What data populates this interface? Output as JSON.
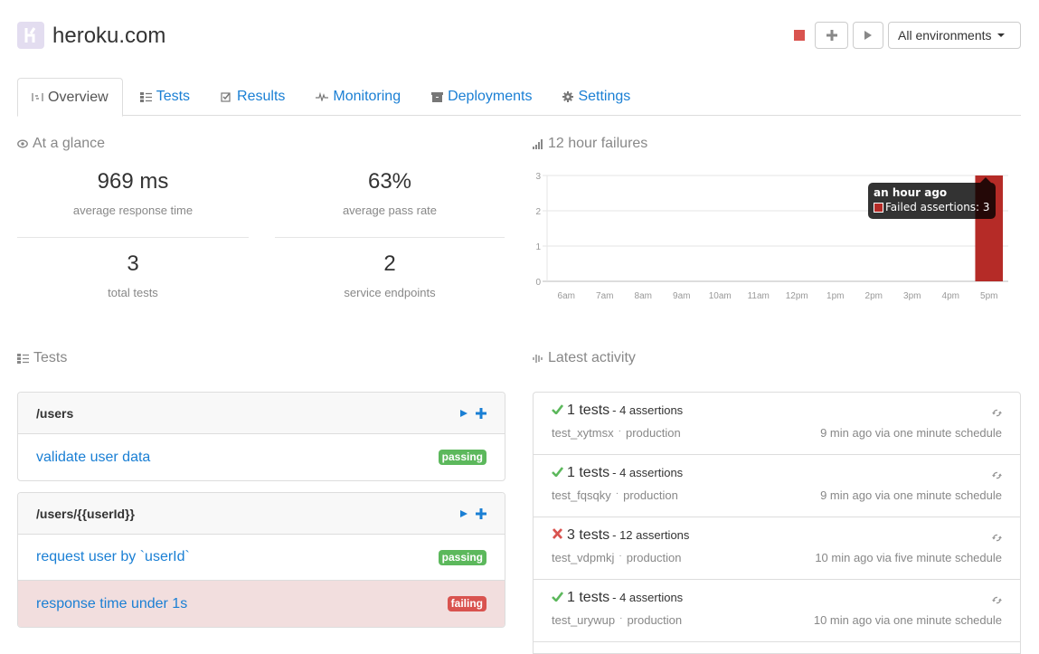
{
  "header": {
    "site_title": "heroku.com",
    "logo_icon": "heroku-logo-icon",
    "status_color": "#d9534f",
    "add_icon": "plus-icon",
    "run_icon": "play-icon",
    "environment_select": "All environments"
  },
  "tabs": [
    {
      "label": "Overview",
      "icon": "overview-icon",
      "active": true
    },
    {
      "label": "Tests",
      "icon": "tests-list-icon",
      "active": false
    },
    {
      "label": "Results",
      "icon": "checkbox-icon",
      "active": false
    },
    {
      "label": "Monitoring",
      "icon": "pulse-icon",
      "active": false
    },
    {
      "label": "Deployments",
      "icon": "archive-icon",
      "active": false
    },
    {
      "label": "Settings",
      "icon": "gear-icon",
      "active": false
    }
  ],
  "glance": {
    "title": "At a glance",
    "stats": [
      {
        "value": "969 ms",
        "label": "average response time"
      },
      {
        "value": "63%",
        "label": "average pass rate"
      },
      {
        "value": "3",
        "label": "total tests"
      },
      {
        "value": "2",
        "label": "service endpoints"
      }
    ]
  },
  "failures": {
    "title": "12 hour failures",
    "tooltip": {
      "title": "an hour ago",
      "series": "Failed assertions",
      "value": "3",
      "text": "Failed assertions: 3"
    }
  },
  "chart_data": {
    "type": "bar",
    "title": "12 hour failures",
    "categories": [
      "6am",
      "7am",
      "8am",
      "9am",
      "10am",
      "11am",
      "12pm",
      "1pm",
      "2pm",
      "3pm",
      "4pm",
      "5pm"
    ],
    "series": [
      {
        "name": "Failed assertions",
        "values": [
          0,
          0,
          0,
          0,
          0,
          0,
          0,
          0,
          0,
          0,
          0,
          3
        ],
        "color": "#b52b27"
      }
    ],
    "yticks": [
      "0",
      "1",
      "2",
      "3"
    ],
    "ylim": [
      0,
      3
    ],
    "xlabel": "",
    "ylabel": "",
    "grid": true
  },
  "tests": {
    "title": "Tests",
    "groups": [
      {
        "endpoint": "/users",
        "items": [
          {
            "name": "validate user data",
            "status": "passing"
          }
        ]
      },
      {
        "endpoint": "/users/{{userId}}",
        "items": [
          {
            "name": "request user by `userId`",
            "status": "passing"
          },
          {
            "name": "response time under 1s",
            "status": "failing"
          }
        ]
      }
    ]
  },
  "activity": {
    "title": "Latest activity",
    "items": [
      {
        "result": "pass",
        "count": "1 tests",
        "assertions": "- 4 assertions",
        "test_id": "test_xytmsx",
        "environment": "production",
        "when": "9 min ago via one minute schedule"
      },
      {
        "result": "pass",
        "count": "1 tests",
        "assertions": "- 4 assertions",
        "test_id": "test_fqsqky",
        "environment": "production",
        "when": "9 min ago via one minute schedule"
      },
      {
        "result": "fail",
        "count": "3 tests",
        "assertions": "- 12 assertions",
        "test_id": "test_vdpmkj",
        "environment": "production",
        "when": "10 min ago via five minute schedule"
      },
      {
        "result": "pass",
        "count": "1 tests",
        "assertions": "- 4 assertions",
        "test_id": "test_urywup",
        "environment": "production",
        "when": "10 min ago via one minute schedule"
      }
    ]
  }
}
